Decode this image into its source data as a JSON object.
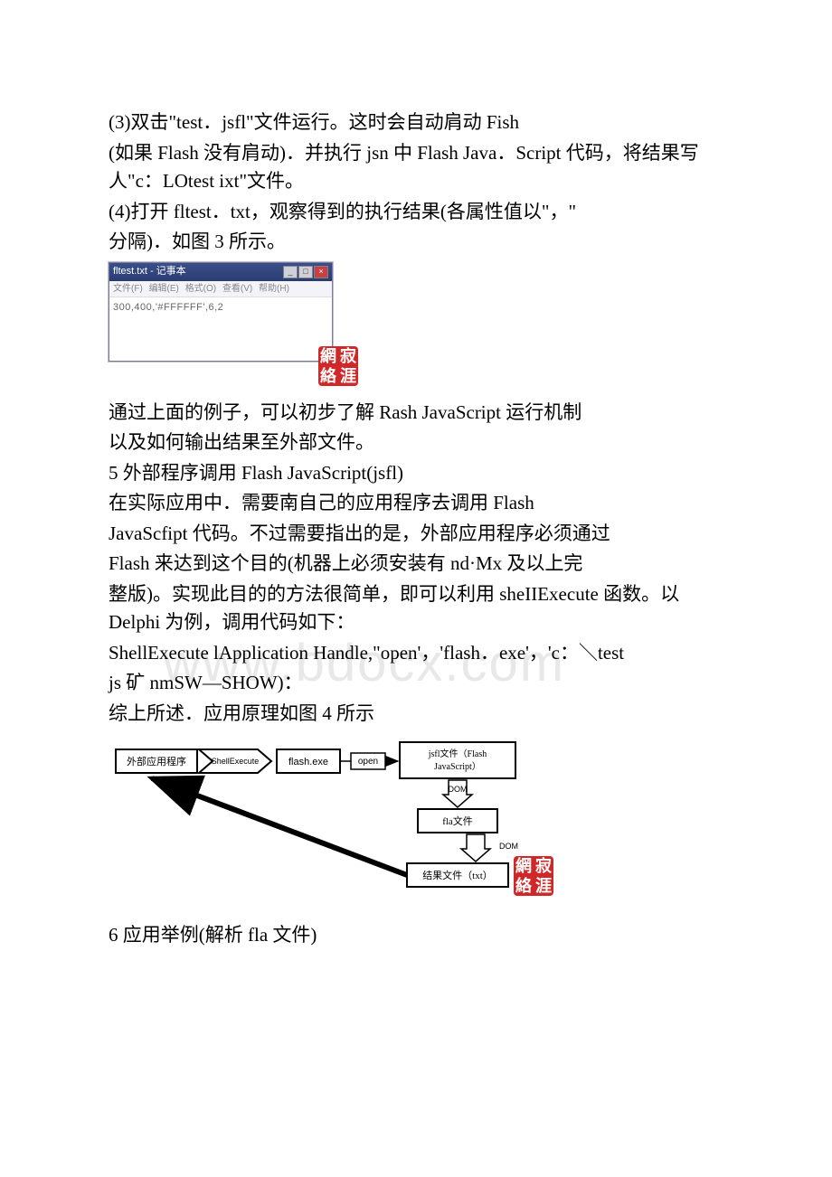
{
  "watermark": "www.bdocx.com",
  "body": {
    "p1": "(3)双击\"test．jsfl\"文件运行。这时会自动肩动 Fish",
    "p2": "(如果 Flash 没有肩动)．并执行 jsn 中 Flash Java．Script 代码，将结果写人\"c：LOtest ixt\"文件。",
    "p3": "(4)打开 fltest．txt，观察得到的执行结果(各属性值以\"，\"",
    "p4": "分隔)．如图 3 所示。",
    "p5": "通过上面的例子，可以初步了解 Rash JavaScript 运行机制",
    "p6": "以及如何输出结果至外部文件。",
    "p7": "5 外部程序调用 Flash JavaScript(jsfl)",
    "p8": "在实际应用中．需要南自己的应用程序去调用 Flash",
    "p9": "JavaScfipt 代码。不过需要指出的是，外部应用程序必须通过",
    "p10": "Flash 来达到这个目的(机器上必须安装有 nd·Mx 及以上完",
    "p11": "整版)。实现此目的的方法很简单，即可以利用 sheIIExecute 函数。以 Delphi 为例，调用代码如下：",
    "p12": "ShellExecute lApplication Handle,\"open'，'flash．exe'，'c：＼test",
    "p13": "js 矿 nmSW—SHOW)：",
    "p14": "综上所述．应用原理如图 4 所示",
    "p15": "6 应用举例(解析 fla 文件)"
  },
  "notepad": {
    "title": "fltest.txt - 记事本",
    "menu": {
      "file": "文件(F)",
      "edit": "编辑(E)",
      "format": "格式(O)",
      "view": "查看(V)",
      "help": "帮助(H)"
    },
    "content": "300,400,'#FFFFFF',6,2"
  },
  "stamp": {
    "c1": "網",
    "c2": "寂",
    "c3": "絡",
    "c4": "涯"
  },
  "diagram": {
    "ext_app": "外部应用程序",
    "shellexec": "ShellExecute",
    "flash_exe": "flash.exe",
    "open": "open",
    "jsfl": "jsfl文件（Flash JavaScript）",
    "dom": "DOM",
    "fla": "fla文件",
    "result": "结果文件（txt）"
  }
}
